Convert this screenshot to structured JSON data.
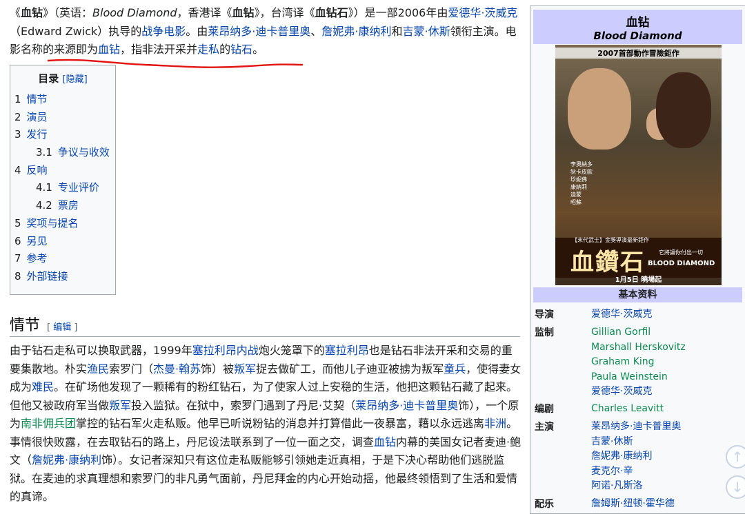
{
  "intro": {
    "open_q": "《",
    "title": "血钻",
    "close_q1": "》（英语：",
    "en_title": "Blood Diamond",
    "hk": "，香港译《",
    "hk_title": "血钻",
    "tw": "》，台湾译《",
    "tw_title": "血钻石",
    "rest1": "》）是一部2006年由",
    "director_link": "爱德华·茨威克",
    "rest2": "（Edward Zwick）执导的",
    "war_film_link": "战争电影",
    "rest3": "。由",
    "actor1_link": "莱昂纳多·迪卡普里奥",
    "sep1": "、",
    "actor2_link": "詹妮弗·康纳利",
    "and": "和",
    "actor3_link": "吉蒙·休斯",
    "rest4": "领衔主演。电影名称的来源即为",
    "blood_diamond_link": "血钻",
    "rest5": "，指非法开采并",
    "smuggle_link": "走私",
    "of": "的",
    "diamond_link": "钻石",
    "end": "。"
  },
  "toc": {
    "title": "目录",
    "hide_label": "[隐藏]",
    "items": [
      {
        "num": "1",
        "label": "情节",
        "sub": false
      },
      {
        "num": "2",
        "label": "演员",
        "sub": false
      },
      {
        "num": "3",
        "label": "发行",
        "sub": false
      },
      {
        "num": "3.1",
        "label": "争议与收效",
        "sub": true
      },
      {
        "num": "4",
        "label": "反响",
        "sub": false
      },
      {
        "num": "4.1",
        "label": "专业评价",
        "sub": true
      },
      {
        "num": "4.2",
        "label": "票房",
        "sub": true
      },
      {
        "num": "5",
        "label": "奖项与提名",
        "sub": false
      },
      {
        "num": "6",
        "label": "另见",
        "sub": false
      },
      {
        "num": "7",
        "label": "参考",
        "sub": false
      },
      {
        "num": "8",
        "label": "外部链接",
        "sub": false
      }
    ]
  },
  "section": {
    "title": "情节",
    "edit_open": "[ ",
    "edit_label": "编辑",
    "edit_close": " ]"
  },
  "plot": {
    "t1": "由于钻石走私可以换取武器，1999年",
    "l1": "塞拉利昂内战",
    "t2": "炮火笼罩下的",
    "l2": "塞拉利昂",
    "t3": "也是钻石非法开采和交易的重要集散地。朴实",
    "l3": "渔民",
    "t4": "索罗门（",
    "l4": "杰曼·翰苏",
    "t5": "饰）被",
    "l5": "叛军",
    "t6": "捉去做矿工，而他儿子迪亚被掳为叛军",
    "l6": "童兵",
    "t7": "，使得妻女成为",
    "l7": "难民",
    "t8": "。在矿场他发现了一颗稀有的粉红钻石，为了使家人过上安稳的生活，他把这颗钻石藏了起来。但他又被政府军当做",
    "l8": "叛军",
    "t9": "投入监狱。在狱中，索罗门遇到了丹尼·艾契（",
    "l9": "莱昂纳多·迪卡普里奥",
    "t10": "饰），一个原为",
    "l10": "南非佣兵团",
    "t11": "掌控的钻石军火走私贩。他早已听说粉钻的消息并打算借此一夜暴富，藉以永远逃离",
    "l11": "非洲",
    "t12": "。事情很快败露，在去取钻石的路上，丹尼设法联系到了一位一面之交，调查",
    "l12": "血钻",
    "t13": "内幕的美国女记者麦迪·鲍文（",
    "l13": "詹妮弗·康纳利",
    "t14": "饰）。女记者深知只有这位走私贩能够引领她走近真相，于是下决心帮助他们逃脱监狱。在麦迪的求真理想和索罗门的非凡勇气面前，丹尼拜金的内心开始动摇，他最终领悟到了生活和爱情的真谛。"
  },
  "infobox": {
    "title": "血钻",
    "subtitle": "Blood Diamond",
    "poster": {
      "top_text": "2007首部動作冒險鉅作",
      "cast_text": "李奧納多\n狄卡皮歐\n珍妮佛\n康納莉\n迪蒙\n昭蘇",
      "tag": "【末代武士】金獎導演最新鉅作",
      "big_title": "血鑽石",
      "slogan": "它將讓你付出一切",
      "en": "BLOOD DIAMOND",
      "date": "1月5日 曉場起"
    },
    "section": "基本资料",
    "rows": [
      {
        "key": "导演",
        "values": [
          "爱德华·茨威克"
        ]
      },
      {
        "key": "监制",
        "values": [
          "Gillian Gorfil",
          "Marshall Herskovitz",
          "Graham King",
          "Paula Weinstein",
          "爱德华·茨威克"
        ]
      },
      {
        "key": "编剧",
        "values": [
          "Charles Leavitt"
        ]
      },
      {
        "key": "主演",
        "values": [
          "莱昂纳多·迪卡普里奥",
          "吉蒙·休斯",
          "詹妮弗·康纳利",
          "麦克尔·辛",
          "阿诺·凡斯洛"
        ]
      },
      {
        "key": "配乐",
        "values": [
          "詹姆斯·纽顿·霍华德"
        ]
      }
    ]
  },
  "nav": {
    "up": "↑",
    "down": "↓"
  }
}
